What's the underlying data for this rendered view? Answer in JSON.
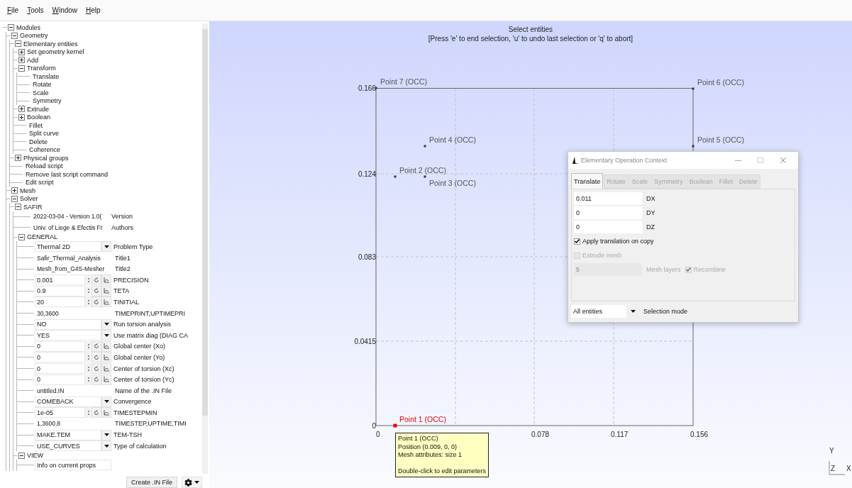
{
  "menu": [
    {
      "label": "File"
    },
    {
      "label": "Tools"
    },
    {
      "label": "Window"
    },
    {
      "label": "Help"
    }
  ],
  "tree": [
    {
      "label": "Modules",
      "expanded": true,
      "children": [
        {
          "label": "Geometry",
          "expanded": true,
          "children": [
            {
              "label": "Elementary entities",
              "expanded": true,
              "children": [
                {
                  "label": "Set geometry kernel",
                  "expanded": false
                },
                {
                  "label": "Add",
                  "expanded": false
                },
                {
                  "label": "Transform",
                  "expanded": true,
                  "children": [
                    {
                      "label": "Translate"
                    },
                    {
                      "label": "Rotate"
                    },
                    {
                      "label": "Scale"
                    },
                    {
                      "label": "Symmetry"
                    }
                  ]
                },
                {
                  "label": "Extrude",
                  "expanded": false
                },
                {
                  "label": "Boolean",
                  "expanded": false
                },
                {
                  "label": "Fillet"
                },
                {
                  "label": "Split curve"
                },
                {
                  "label": "Delete"
                },
                {
                  "label": "Coherence"
                }
              ]
            },
            {
              "label": "Physical groups",
              "expanded": false
            },
            {
              "label": "Reload script"
            },
            {
              "label": "Remove last script command"
            },
            {
              "label": "Edit script"
            }
          ]
        },
        {
          "label": "Mesh",
          "expanded": false
        },
        {
          "label": "Solver",
          "expanded": true,
          "children": [
            {
              "label": "SAFIR",
              "expanded": true,
              "children": [
                {
                  "kind": "text",
                  "value": "2022-03-04 - Version 1.0(",
                  "label": "Version"
                },
                {
                  "kind": "text",
                  "value": "Univ. of Liege & Efectis Fr",
                  "label": "Authors"
                },
                {
                  "label": "GENERAL",
                  "expanded": true,
                  "children": [
                    {
                      "kind": "choice",
                      "value": "Thermal 2D",
                      "label": "Problem Type"
                    },
                    {
                      "kind": "text",
                      "value": "Safir_Thermal_Analysis",
                      "label": "Title1"
                    },
                    {
                      "kind": "text",
                      "value": "Mesh_from_G4S-Mesher",
                      "label": "Title2"
                    },
                    {
                      "kind": "number",
                      "value": "0.001",
                      "label": "PRECISION"
                    },
                    {
                      "kind": "number",
                      "value": "0.9",
                      "label": "TETA"
                    },
                    {
                      "kind": "number",
                      "value": "20",
                      "label": "TINITIAL"
                    },
                    {
                      "kind": "text",
                      "value": "30,3600",
                      "label": "TIMEPRINT,UPTIMEPRI"
                    },
                    {
                      "kind": "choice",
                      "value": "NO",
                      "label": "Run torsion analysis"
                    },
                    {
                      "kind": "choice",
                      "value": "YES",
                      "label": "Use matrix diag (DIAG CA"
                    },
                    {
                      "kind": "number",
                      "value": "0",
                      "label": "Global center (Xo)"
                    },
                    {
                      "kind": "number",
                      "value": "0",
                      "label": "Global center (Yo)"
                    },
                    {
                      "kind": "number",
                      "value": "0",
                      "label": "Center of torsion (Xc)"
                    },
                    {
                      "kind": "number",
                      "value": "0",
                      "label": "Center of torsion (Yc)"
                    },
                    {
                      "kind": "text",
                      "value": "untitled.IN",
                      "label": "Name of the .IN File"
                    },
                    {
                      "kind": "choice",
                      "value": "COMEBACK",
                      "label": "Convergence"
                    },
                    {
                      "kind": "number",
                      "value": "1e-05",
                      "label": "TIMESTEPMIN"
                    },
                    {
                      "kind": "text",
                      "value": "1,3600,8",
                      "label": "TIMESTEP,UPTIME,TIMI"
                    },
                    {
                      "kind": "choice",
                      "value": "MAKE.TEM",
                      "label": "TEM-TSH"
                    },
                    {
                      "kind": "choice",
                      "value": "USE_CURVES",
                      "label": "Type of calculation"
                    }
                  ]
                },
                {
                  "label": "VIEW",
                  "expanded": true,
                  "children": [
                    {
                      "kind": "action",
                      "value": "Info on current props"
                    }
                  ]
                }
              ]
            }
          ]
        }
      ]
    }
  ],
  "create_button": "Create .IN File",
  "canvas": {
    "title": "Select entities",
    "hint": "[Press 'e' to end selection, 'u' to undo last selection or 'q' to abort]",
    "yticks": [
      "0.166",
      "0.124",
      "0.083",
      "0.0415",
      "0"
    ],
    "xticks": [
      "0",
      "0.078",
      "0.117",
      "0.156"
    ],
    "points": [
      {
        "label": "Point 7 (OCC)",
        "selected": false
      },
      {
        "label": "Point 6 (OCC)",
        "selected": false
      },
      {
        "label": "Point 4 (OCC)",
        "selected": false
      },
      {
        "label": "Point 5 (OCC)",
        "selected": false
      },
      {
        "label": "Point 2 (OCC)",
        "selected": false
      },
      {
        "label": "Point 3 (OCC)",
        "selected": false
      },
      {
        "label": "Point 1 (OCC)",
        "selected": true
      }
    ],
    "tooltip": {
      "title": "Point 1 (OCC)",
      "details": [
        "Position (0.009, 0, 0)",
        "Mesh attributes: size 1"
      ],
      "hint": "Double-click to edit parameters"
    },
    "axes": {
      "y": "Y",
      "z": "Z",
      "x": "X"
    }
  },
  "dialog": {
    "title": "Elementary Operation Context",
    "tabs": [
      {
        "label": "Translate",
        "selected": true,
        "disabled": false
      },
      {
        "label": "Rotate",
        "selected": false,
        "disabled": true
      },
      {
        "label": "Scale",
        "selected": false,
        "disabled": true
      },
      {
        "label": "Symmetry",
        "selected": false,
        "disabled": true
      },
      {
        "label": "Boolean",
        "selected": false,
        "disabled": true
      },
      {
        "label": "Fillet",
        "selected": false,
        "disabled": true
      },
      {
        "label": "Delete",
        "selected": false,
        "disabled": true
      }
    ],
    "fields": [
      {
        "value": "0.011",
        "label": "DX"
      },
      {
        "value": "0",
        "label": "DY"
      },
      {
        "value": "0",
        "label": "DZ"
      }
    ],
    "apply_copy": {
      "label": "Apply translation on copy",
      "checked": true,
      "disabled": false
    },
    "extrude_mesh": {
      "label": "Extrude mesh",
      "checked": false,
      "disabled": true
    },
    "mesh_layers": {
      "value": "5",
      "label": "Mesh layers",
      "disabled": true
    },
    "recombine": {
      "label": "Recombine",
      "checked": true,
      "disabled": true
    },
    "selection": {
      "value": "All entities",
      "label": "Selection mode"
    }
  }
}
